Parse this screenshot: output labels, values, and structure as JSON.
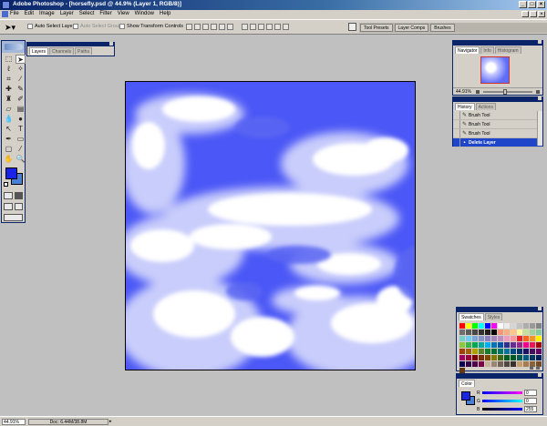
{
  "window": {
    "title": "Adobe Photoshop - [horsefly.psd @ 44.9% (Layer 1, RGB/8)]"
  },
  "menu": {
    "items": [
      "File",
      "Edit",
      "Image",
      "Layer",
      "Select",
      "Filter",
      "View",
      "Window",
      "Help"
    ]
  },
  "options": {
    "auto_select_layer": "Auto Select Layer",
    "auto_select_groups": "Auto Select Groups",
    "show_transform_controls": "Show Transform Controls"
  },
  "palette_well": {
    "tabs": [
      "Tool Presets",
      "Layer Comps",
      "Brushes"
    ]
  },
  "layers_palette": {
    "tabs": [
      "Layers",
      "Channels",
      "Paths"
    ]
  },
  "navigator": {
    "tabs": [
      "Navigator",
      "Info",
      "Histogram"
    ],
    "zoom": "44.91%"
  },
  "history": {
    "tabs": [
      "History",
      "Actions"
    ],
    "items": [
      "Brush Tool",
      "Brush Tool",
      "Brush Tool",
      "Delete Layer"
    ]
  },
  "swatches": {
    "tabs": [
      "Swatches",
      "Styles"
    ],
    "colors": [
      "#ff0000",
      "#ffff00",
      "#00ff00",
      "#00ffff",
      "#0000ff",
      "#ff00ff",
      "#ffffff",
      "#ebebeb",
      "#d6d6d6",
      "#c2c2c2",
      "#adadad",
      "#999999",
      "#858585",
      "#707070",
      "#5c5c5c",
      "#474747",
      "#333333",
      "#1f1f1f",
      "#000000",
      "#f7977a",
      "#fbad82",
      "#fdc68c",
      "#fff79a",
      "#c7df9e",
      "#a3d39c",
      "#82ca9d",
      "#7bcdc8",
      "#6ecff6",
      "#7ea7d8",
      "#8493ca",
      "#8882be",
      "#a187be",
      "#bc8dbf",
      "#f49ac2",
      "#f6989d",
      "#ed1c24",
      "#f26522",
      "#f7941d",
      "#fff200",
      "#8dc63f",
      "#39b54a",
      "#00a651",
      "#00a99d",
      "#00aeef",
      "#0072bc",
      "#0054a6",
      "#2e3192",
      "#662d91",
      "#92278f",
      "#ec008c",
      "#ed145b",
      "#9e0b0f",
      "#a0410d",
      "#a36209",
      "#aba000",
      "#598527",
      "#1a7b30",
      "#007236",
      "#00746b",
      "#0076a3",
      "#004a80",
      "#003471",
      "#1b1464",
      "#440e62",
      "#630460",
      "#9e005d",
      "#9e0039",
      "#790000",
      "#7b2e00",
      "#7d4900",
      "#827b00",
      "#406618",
      "#005e20",
      "#005826",
      "#005952",
      "#005b7f",
      "#003663",
      "#002157",
      "#0d004c",
      "#32004b",
      "#4b0049",
      "#7b0046",
      "#c7b299",
      "#998675",
      "#736357",
      "#534741",
      "#37302d",
      "#c69c6d",
      "#a67c52",
      "#8c6239",
      "#754c24",
      "#603913"
    ]
  },
  "color_palette": {
    "tabs": [
      "Color"
    ],
    "channels": [
      {
        "label": "R",
        "value": "0"
      },
      {
        "label": "G",
        "value": "0"
      },
      {
        "label": "B",
        "value": "255"
      }
    ],
    "foreground": "#1a24e8",
    "background": "#4a7fd4"
  },
  "status": {
    "zoom": "44.91%",
    "doc": "Doc: 6.44M/38.8M"
  },
  "canvas": {
    "sky_color": "#4b57f6"
  }
}
